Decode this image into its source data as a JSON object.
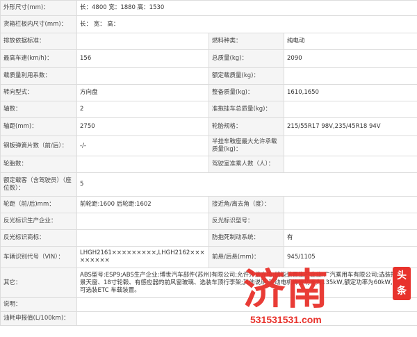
{
  "rows": [
    {
      "l1": "外形尺寸(mm)：",
      "v1": "长：4800 宽：1880 高：1530"
    },
    {
      "l1": "货箱栏板内尺寸(mm)：",
      "v1": "长： 宽： 高："
    },
    {
      "l1": "排放依据标准：",
      "v1": "",
      "l2": "燃料种类：",
      "v2": "纯电动"
    },
    {
      "l1": "最高车速(km/h)：",
      "v1": "156",
      "l2": "总质量(kg)：",
      "v2": "2090"
    },
    {
      "l1": "载质量利用系数：",
      "v1": "",
      "l2": "额定载质量(kg)：",
      "v2": ""
    },
    {
      "l1": "转向型式：",
      "v1": "方向盘",
      "l2": "整备质量(kg)：",
      "v2": "1610,1650"
    },
    {
      "l1": "轴数：",
      "v1": "2",
      "l2": "准拖挂车总质量(kg)：",
      "v2": ""
    },
    {
      "l1": "轴距(mm)：",
      "v1": "2750",
      "l2": "轮胎规格：",
      "v2": "215/55R17 98V,235/45R18 94V"
    },
    {
      "l1": "钢板弹簧片数（前/后）：",
      "v1": "-/-",
      "l2": "半挂车鞍座最大允许承载质量(kg)：",
      "v2": ""
    },
    {
      "l1": "轮胎数：",
      "v1": "",
      "l2": "驾驶室准乘人数（人）：",
      "v2": ""
    },
    {
      "l1": "额定载客（含驾驶员）（座位数）：",
      "v1": "5"
    },
    {
      "l1": "轮距（前/后)mm：",
      "v1": "前轮距:1600 后轮距:1602",
      "l2": "接近角/离去角（度）：",
      "v2": ""
    },
    {
      "l1": "反光标识生产企业：",
      "v1": "",
      "l2": "反光标识型号：",
      "v2": ""
    },
    {
      "l1": "反光标识商标：",
      "v1": "",
      "l2": "防抱死制动系统：",
      "v2": "有"
    },
    {
      "l1": "车辆识别代号（VIN）：",
      "v1": "LHGH2161×××××××××,LHGH2162×××××××××",
      "l2": "前悬/后悬(mm)：",
      "v2": "945/1105"
    },
    {
      "l1": "其它：",
      "v1": "ABS型号:ESP9;ABS生产企业:博世汽车部件(苏州)有限公司;允许外接充电;储能装置生产企业:广汽乘用车有限公司;选装描述:全景天窗、18寸轮毂、有感应器的前风窗玻璃、选装车顶行李架;其他说明:驱动电机峰值功率为135kW,额定功率为60kW,该车型可选装ETC 车载装置。"
    },
    {
      "l1": "说明：",
      "v1": ""
    },
    {
      "l1": "油耗申报值(L/100km)：",
      "v1": ""
    }
  ],
  "watermark": {
    "text": "济南",
    "seal": "头条",
    "url": "531531531.com"
  }
}
